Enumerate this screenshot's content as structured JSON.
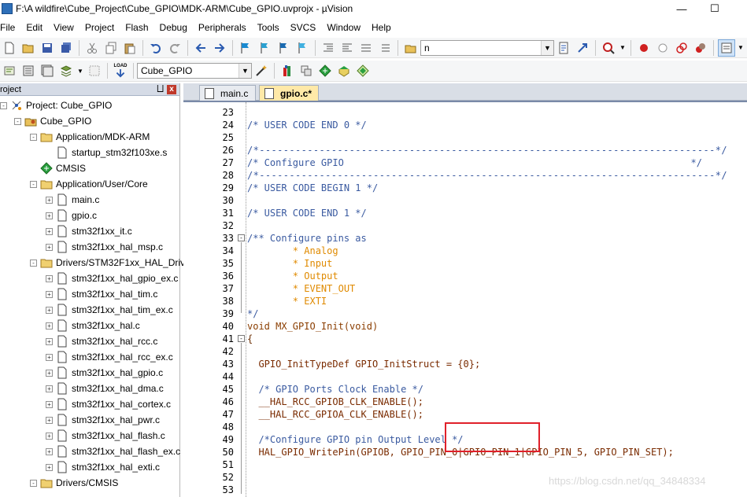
{
  "window": {
    "title": "F:\\A wildfire\\Cube_Project\\Cube_GPIO\\MDK-ARM\\Cube_GPIO.uvprojx - µVision",
    "minimize_glyph": "—",
    "maximize_glyph": "☐"
  },
  "menu": {
    "items": [
      "File",
      "Edit",
      "View",
      "Project",
      "Flash",
      "Debug",
      "Peripherals",
      "Tools",
      "SVCS",
      "Window",
      "Help"
    ]
  },
  "toolbar1": {
    "find_combo_value": "n"
  },
  "toolbar2": {
    "target_combo_value": "Cube_GPIO",
    "load_label": "LOAD"
  },
  "project_panel": {
    "title": "roject",
    "pin_glyph": "⨆",
    "close_glyph": "x",
    "tree": [
      {
        "label": "Project: Cube_GPIO",
        "type": "project",
        "expander": "-"
      },
      {
        "label": "Cube_GPIO",
        "type": "target",
        "expander": "-"
      },
      {
        "label": "Application/MDK-ARM",
        "type": "folder",
        "expander": "-"
      },
      {
        "label": "startup_stm32f103xe.s",
        "type": "file",
        "expander": ""
      },
      {
        "label": "CMSIS",
        "type": "component",
        "expander": ""
      },
      {
        "label": "Application/User/Core",
        "type": "folder",
        "expander": "-"
      },
      {
        "label": "main.c",
        "type": "file",
        "expander": "+"
      },
      {
        "label": "gpio.c",
        "type": "file",
        "expander": "+"
      },
      {
        "label": "stm32f1xx_it.c",
        "type": "file",
        "expander": "+"
      },
      {
        "label": "stm32f1xx_hal_msp.c",
        "type": "file",
        "expander": "+"
      },
      {
        "label": "Drivers/STM32F1xx_HAL_Driv",
        "type": "folder",
        "expander": "-"
      },
      {
        "label": "stm32f1xx_hal_gpio_ex.c",
        "type": "file",
        "expander": "+"
      },
      {
        "label": "stm32f1xx_hal_tim.c",
        "type": "file",
        "expander": "+"
      },
      {
        "label": "stm32f1xx_hal_tim_ex.c",
        "type": "file",
        "expander": "+"
      },
      {
        "label": "stm32f1xx_hal.c",
        "type": "file",
        "expander": "+"
      },
      {
        "label": "stm32f1xx_hal_rcc.c",
        "type": "file",
        "expander": "+"
      },
      {
        "label": "stm32f1xx_hal_rcc_ex.c",
        "type": "file",
        "expander": "+"
      },
      {
        "label": "stm32f1xx_hal_gpio.c",
        "type": "file",
        "expander": "+"
      },
      {
        "label": "stm32f1xx_hal_dma.c",
        "type": "file",
        "expander": "+"
      },
      {
        "label": "stm32f1xx_hal_cortex.c",
        "type": "file",
        "expander": "+"
      },
      {
        "label": "stm32f1xx_hal_pwr.c",
        "type": "file",
        "expander": "+"
      },
      {
        "label": "stm32f1xx_hal_flash.c",
        "type": "file",
        "expander": "+"
      },
      {
        "label": "stm32f1xx_hal_flash_ex.c",
        "type": "file",
        "expander": "+"
      },
      {
        "label": "stm32f1xx_hal_exti.c",
        "type": "file",
        "expander": "+"
      },
      {
        "label": "Drivers/CMSIS",
        "type": "folder",
        "expander": "-"
      }
    ]
  },
  "editor": {
    "tabs": [
      {
        "label": "main.c",
        "active": false
      },
      {
        "label": "gpio.c*",
        "active": true
      }
    ],
    "lines": [
      {
        "no": "23",
        "text": "",
        "kind": "norm"
      },
      {
        "no": "24",
        "text": "/* USER CODE END 0 */",
        "kind": "comment"
      },
      {
        "no": "25",
        "text": "",
        "kind": "norm"
      },
      {
        "no": "26",
        "text": "/*----------------------------------------------------------------------------*/",
        "kind": "comment-s"
      },
      {
        "no": "27",
        "text": "/* Configure GPIO                                                             */",
        "kind": "comment"
      },
      {
        "no": "28",
        "text": "/*----------------------------------------------------------------------------*/",
        "kind": "comment-s"
      },
      {
        "no": "29",
        "text": "/* USER CODE BEGIN 1 */",
        "kind": "comment"
      },
      {
        "no": "30",
        "text": "",
        "kind": "norm"
      },
      {
        "no": "31",
        "text": "/* USER CODE END 1 */",
        "kind": "comment"
      },
      {
        "no": "32",
        "text": "",
        "kind": "norm"
      },
      {
        "no": "33",
        "text": "/** Configure pins as",
        "kind": "comment"
      },
      {
        "no": "34",
        "text": "        * Analog",
        "kind": "dot"
      },
      {
        "no": "35",
        "text": "        * Input",
        "kind": "dot"
      },
      {
        "no": "36",
        "text": "        * Output",
        "kind": "dot"
      },
      {
        "no": "37",
        "text": "        * EVENT_OUT",
        "kind": "dot"
      },
      {
        "no": "38",
        "text": "        * EXTI",
        "kind": "dot"
      },
      {
        "no": "39",
        "text": "*/",
        "kind": "comment"
      },
      {
        "no": "40",
        "text": "void MX_GPIO_Init(void)",
        "kind": "kw"
      },
      {
        "no": "41",
        "text": "{",
        "kind": "norm"
      },
      {
        "no": "42",
        "text": "",
        "kind": "norm"
      },
      {
        "no": "43",
        "text": "  GPIO_InitTypeDef GPIO_InitStruct = {0};",
        "kind": "fn"
      },
      {
        "no": "44",
        "text": "",
        "kind": "norm"
      },
      {
        "no": "45",
        "text": "  /* GPIO Ports Clock Enable */",
        "kind": "comment"
      },
      {
        "no": "46",
        "text": "  __HAL_RCC_GPIOB_CLK_ENABLE();",
        "kind": "fn"
      },
      {
        "no": "47",
        "text": "  __HAL_RCC_GPIOA_CLK_ENABLE();",
        "kind": "fn"
      },
      {
        "no": "48",
        "text": "",
        "kind": "norm"
      },
      {
        "no": "49",
        "text": "  /*Configure GPIO pin Output Level */",
        "kind": "comment"
      },
      {
        "no": "50",
        "text": "  HAL_GPIO_WritePin(GPIOB, GPIO_PIN_0|GPIO_PIN_1|GPIO_PIN_5, GPIO_PIN_SET);",
        "kind": "fn"
      },
      {
        "no": "51",
        "text": "",
        "kind": "norm"
      },
      {
        "no": "52",
        "text": "",
        "kind": "norm"
      },
      {
        "no": "53",
        "text": "",
        "kind": "norm"
      }
    ]
  },
  "watermark": "https://blog.csdn.net/qq_34848334",
  "colors": {
    "comment": "#3a5aa0",
    "keyword": "#8a3d00",
    "highlight_box": "#e0202a",
    "active_tab": "#ffe9a8"
  }
}
